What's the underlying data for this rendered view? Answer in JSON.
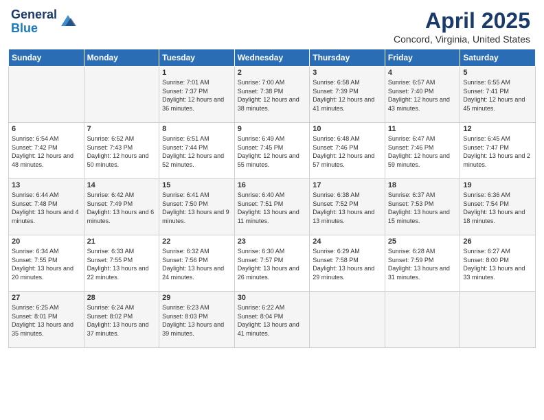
{
  "logo": {
    "general": "General",
    "blue": "Blue"
  },
  "header": {
    "month": "April 2025",
    "location": "Concord, Virginia, United States"
  },
  "days_of_week": [
    "Sunday",
    "Monday",
    "Tuesday",
    "Wednesday",
    "Thursday",
    "Friday",
    "Saturday"
  ],
  "weeks": [
    [
      {
        "day": "",
        "info": ""
      },
      {
        "day": "",
        "info": ""
      },
      {
        "day": "1",
        "info": "Sunrise: 7:01 AM\nSunset: 7:37 PM\nDaylight: 12 hours and 36 minutes."
      },
      {
        "day": "2",
        "info": "Sunrise: 7:00 AM\nSunset: 7:38 PM\nDaylight: 12 hours and 38 minutes."
      },
      {
        "day": "3",
        "info": "Sunrise: 6:58 AM\nSunset: 7:39 PM\nDaylight: 12 hours and 41 minutes."
      },
      {
        "day": "4",
        "info": "Sunrise: 6:57 AM\nSunset: 7:40 PM\nDaylight: 12 hours and 43 minutes."
      },
      {
        "day": "5",
        "info": "Sunrise: 6:55 AM\nSunset: 7:41 PM\nDaylight: 12 hours and 45 minutes."
      }
    ],
    [
      {
        "day": "6",
        "info": "Sunrise: 6:54 AM\nSunset: 7:42 PM\nDaylight: 12 hours and 48 minutes."
      },
      {
        "day": "7",
        "info": "Sunrise: 6:52 AM\nSunset: 7:43 PM\nDaylight: 12 hours and 50 minutes."
      },
      {
        "day": "8",
        "info": "Sunrise: 6:51 AM\nSunset: 7:44 PM\nDaylight: 12 hours and 52 minutes."
      },
      {
        "day": "9",
        "info": "Sunrise: 6:49 AM\nSunset: 7:45 PM\nDaylight: 12 hours and 55 minutes."
      },
      {
        "day": "10",
        "info": "Sunrise: 6:48 AM\nSunset: 7:46 PM\nDaylight: 12 hours and 57 minutes."
      },
      {
        "day": "11",
        "info": "Sunrise: 6:47 AM\nSunset: 7:46 PM\nDaylight: 12 hours and 59 minutes."
      },
      {
        "day": "12",
        "info": "Sunrise: 6:45 AM\nSunset: 7:47 PM\nDaylight: 13 hours and 2 minutes."
      }
    ],
    [
      {
        "day": "13",
        "info": "Sunrise: 6:44 AM\nSunset: 7:48 PM\nDaylight: 13 hours and 4 minutes."
      },
      {
        "day": "14",
        "info": "Sunrise: 6:42 AM\nSunset: 7:49 PM\nDaylight: 13 hours and 6 minutes."
      },
      {
        "day": "15",
        "info": "Sunrise: 6:41 AM\nSunset: 7:50 PM\nDaylight: 13 hours and 9 minutes."
      },
      {
        "day": "16",
        "info": "Sunrise: 6:40 AM\nSunset: 7:51 PM\nDaylight: 13 hours and 11 minutes."
      },
      {
        "day": "17",
        "info": "Sunrise: 6:38 AM\nSunset: 7:52 PM\nDaylight: 13 hours and 13 minutes."
      },
      {
        "day": "18",
        "info": "Sunrise: 6:37 AM\nSunset: 7:53 PM\nDaylight: 13 hours and 15 minutes."
      },
      {
        "day": "19",
        "info": "Sunrise: 6:36 AM\nSunset: 7:54 PM\nDaylight: 13 hours and 18 minutes."
      }
    ],
    [
      {
        "day": "20",
        "info": "Sunrise: 6:34 AM\nSunset: 7:55 PM\nDaylight: 13 hours and 20 minutes."
      },
      {
        "day": "21",
        "info": "Sunrise: 6:33 AM\nSunset: 7:55 PM\nDaylight: 13 hours and 22 minutes."
      },
      {
        "day": "22",
        "info": "Sunrise: 6:32 AM\nSunset: 7:56 PM\nDaylight: 13 hours and 24 minutes."
      },
      {
        "day": "23",
        "info": "Sunrise: 6:30 AM\nSunset: 7:57 PM\nDaylight: 13 hours and 26 minutes."
      },
      {
        "day": "24",
        "info": "Sunrise: 6:29 AM\nSunset: 7:58 PM\nDaylight: 13 hours and 29 minutes."
      },
      {
        "day": "25",
        "info": "Sunrise: 6:28 AM\nSunset: 7:59 PM\nDaylight: 13 hours and 31 minutes."
      },
      {
        "day": "26",
        "info": "Sunrise: 6:27 AM\nSunset: 8:00 PM\nDaylight: 13 hours and 33 minutes."
      }
    ],
    [
      {
        "day": "27",
        "info": "Sunrise: 6:25 AM\nSunset: 8:01 PM\nDaylight: 13 hours and 35 minutes."
      },
      {
        "day": "28",
        "info": "Sunrise: 6:24 AM\nSunset: 8:02 PM\nDaylight: 13 hours and 37 minutes."
      },
      {
        "day": "29",
        "info": "Sunrise: 6:23 AM\nSunset: 8:03 PM\nDaylight: 13 hours and 39 minutes."
      },
      {
        "day": "30",
        "info": "Sunrise: 6:22 AM\nSunset: 8:04 PM\nDaylight: 13 hours and 41 minutes."
      },
      {
        "day": "",
        "info": ""
      },
      {
        "day": "",
        "info": ""
      },
      {
        "day": "",
        "info": ""
      }
    ]
  ]
}
